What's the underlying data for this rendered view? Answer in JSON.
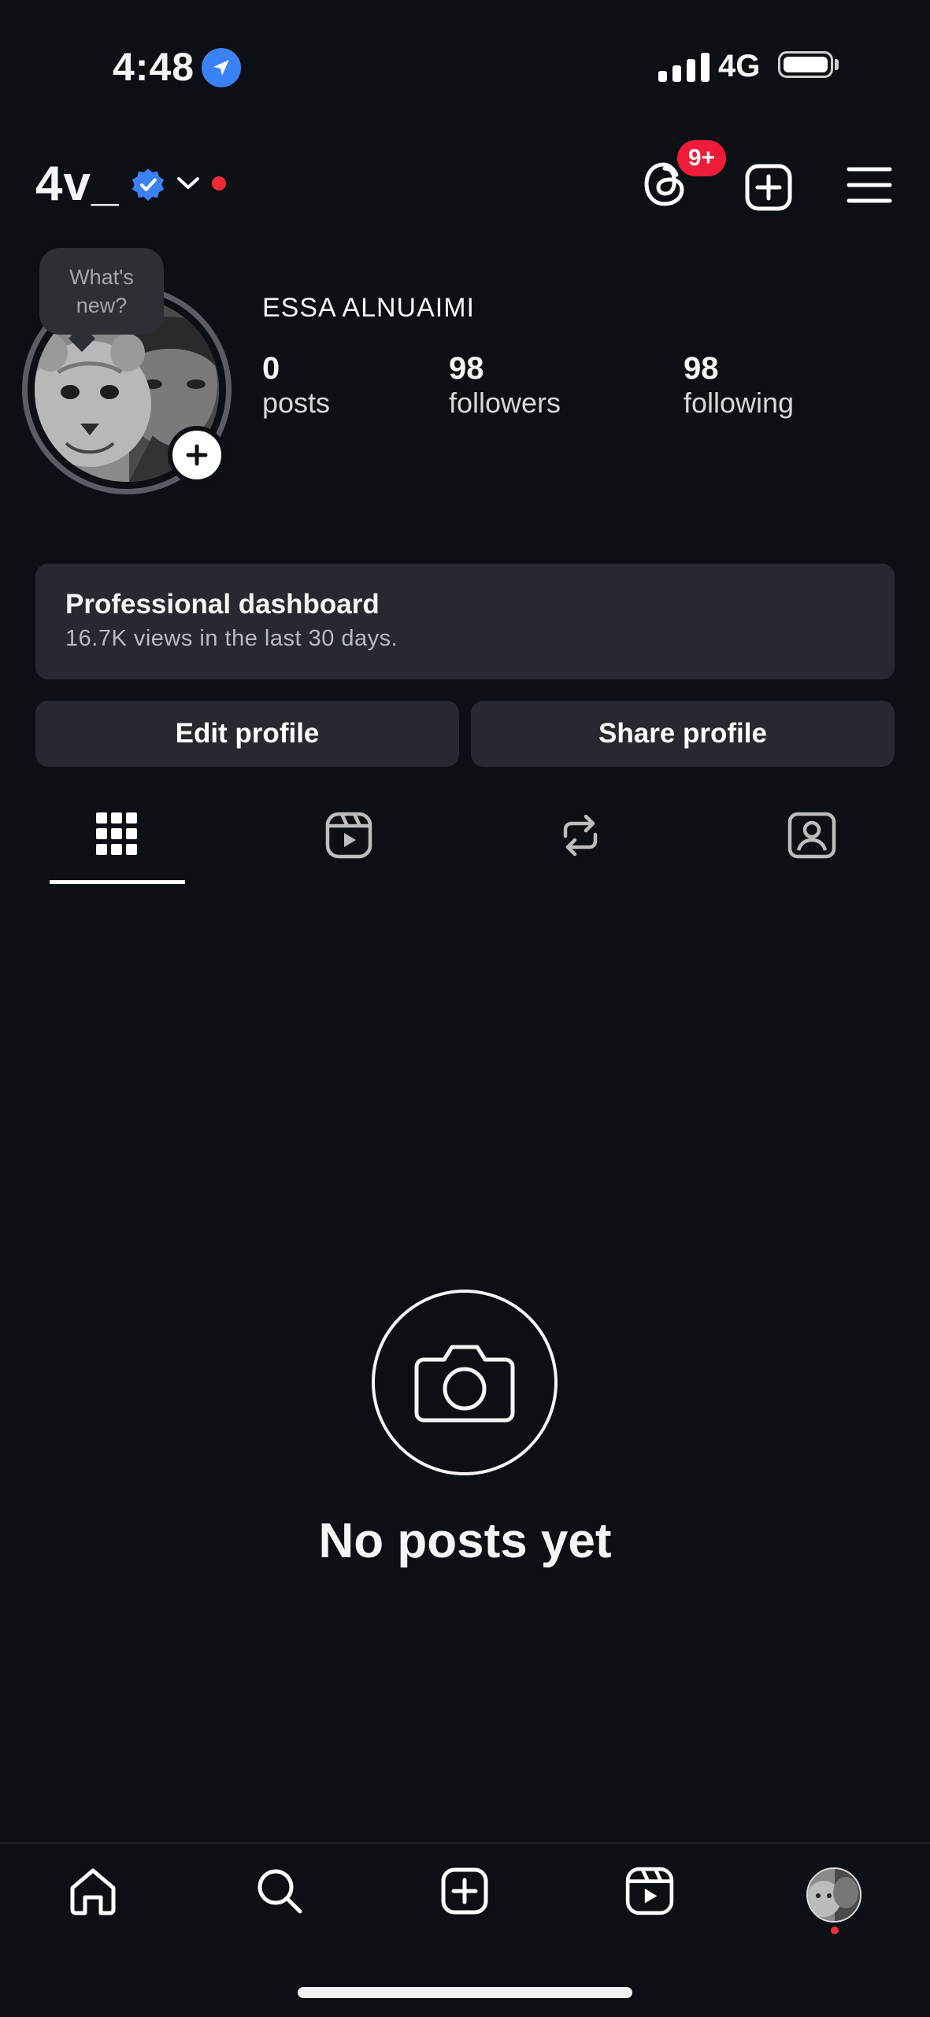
{
  "status_bar": {
    "time": "4:48",
    "network": "4G"
  },
  "header": {
    "username": "4v_",
    "notification_badge": "9+",
    "icons": [
      "verified-badge-icon",
      "chevron-down-icon",
      "threads-icon",
      "create-plus-icon",
      "hamburger-menu-icon"
    ]
  },
  "story": {
    "bubble_text": "What's new?"
  },
  "profile": {
    "display_name": "ESSA ALNUAIMI",
    "stats": [
      {
        "value": "0",
        "label": "posts"
      },
      {
        "value": "98",
        "label": "followers"
      },
      {
        "value": "98",
        "label": "following"
      }
    ]
  },
  "dashboard": {
    "title": "Professional dashboard",
    "subtitle": "16.7K views in the last 30 days."
  },
  "actions": {
    "edit": "Edit profile",
    "share": "Share profile"
  },
  "tabs": [
    "grid-icon",
    "reels-icon",
    "reposts-icon",
    "tagged-icon"
  ],
  "empty_state": {
    "text": "No posts yet"
  },
  "bottom_nav": [
    "home-icon",
    "search-icon",
    "create-icon",
    "reels-icon",
    "profile-avatar"
  ],
  "colors": {
    "background": "#0c0f14",
    "surface": "#262a30",
    "accent_red": "#ee1b3a",
    "verified_blue": "#3b82f6"
  }
}
